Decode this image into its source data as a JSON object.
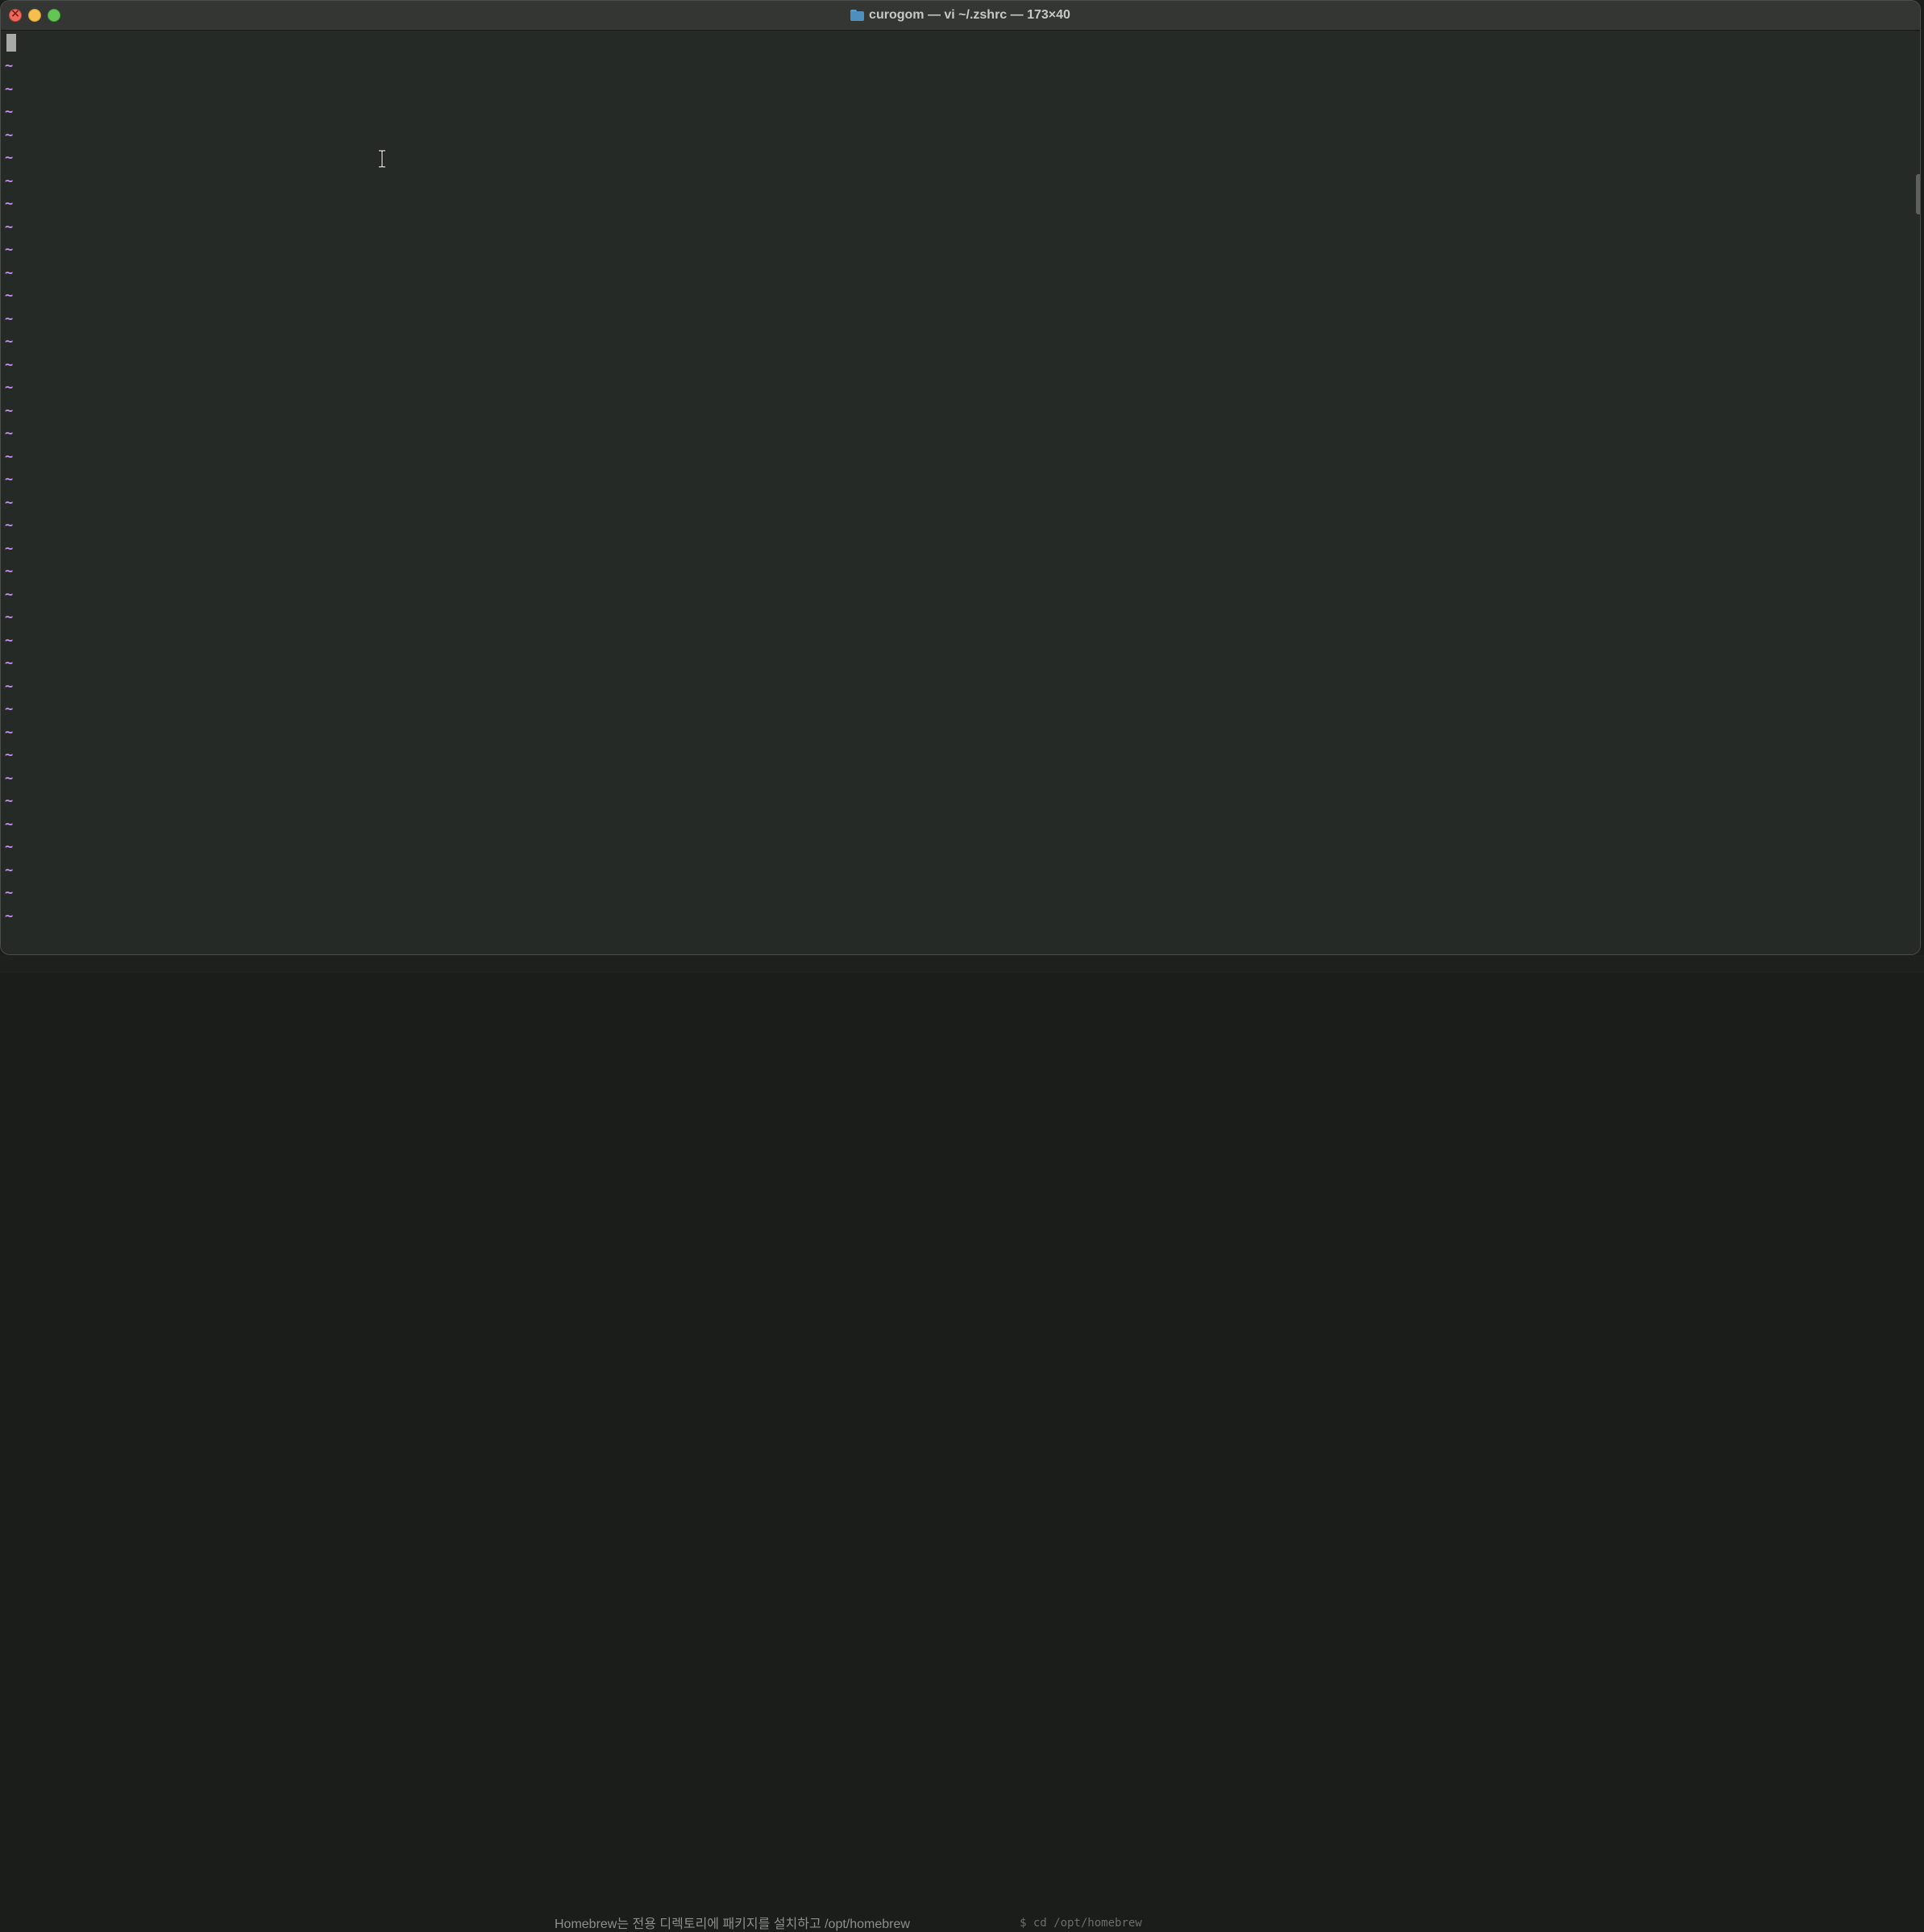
{
  "window": {
    "title": "curogom — vi ~/.zshrc — 173×40",
    "folder_icon": "folder-icon"
  },
  "colors": {
    "terminal_bg": "#262a26",
    "titlebar_bg": "#343634",
    "tilde": "#c58ef0",
    "cursor": "#a8aaa8",
    "close": "#ed6a5e",
    "minimize": "#f5bf4f",
    "zoom": "#62c554"
  },
  "editor": {
    "empty_line_marker": "~",
    "empty_line_count": 38
  },
  "background": {
    "text": "Homebrew는 전용 디렉토리에 패키지를 설치하고 /opt/homebrew",
    "text_secondary": "$ cd /opt/homebrew"
  }
}
